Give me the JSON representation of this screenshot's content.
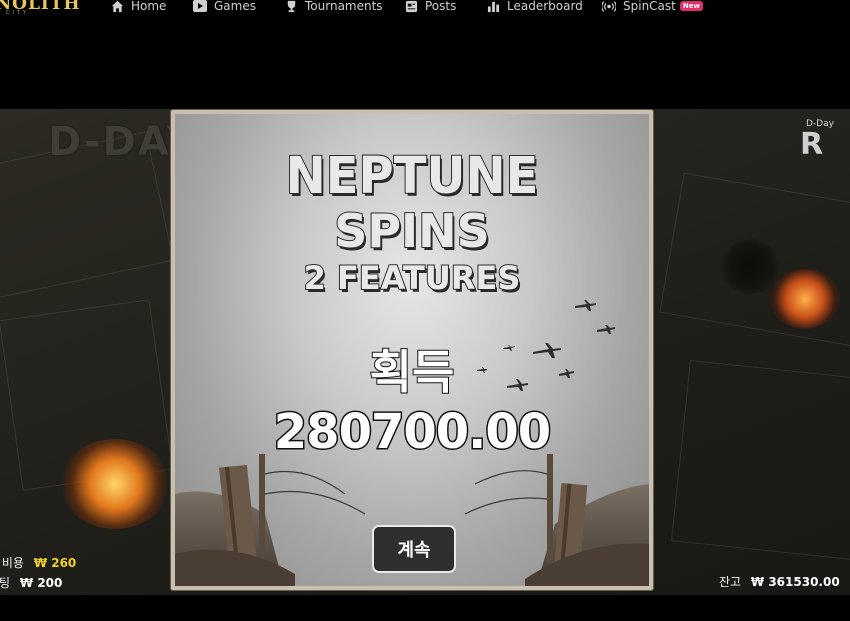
{
  "logo": {
    "text": "MONOLITH",
    "sub": "CITY"
  },
  "nav": [
    {
      "label": "Home",
      "icon": "home-icon"
    },
    {
      "label": "Games",
      "icon": "play-icon"
    },
    {
      "label": "Tournaments",
      "icon": "trophy-icon"
    },
    {
      "label": "Posts",
      "icon": "posts-icon"
    },
    {
      "label": "Leaderboard",
      "icon": "leaderboard-icon"
    },
    {
      "label": "SpinCast",
      "icon": "broadcast-icon",
      "badge": "New"
    }
  ],
  "game": {
    "title": "D-DAY",
    "rating_label": "D-Day",
    "rating_letter": "R",
    "cost_label": "구매 비용",
    "cost_value": "₩ 260",
    "bet_label": "베팅",
    "bet_value": "₩ 200",
    "balance_label": "잔고",
    "balance_value": "₩ 361530.00"
  },
  "modal": {
    "title_line1": "NEPTUNE",
    "title_line2": "SPINS",
    "title_line3": "2 FEATURES",
    "win_label": "획득",
    "win_amount": "280700.00",
    "continue_label": "계속"
  },
  "colors": {
    "accent_gold": "#f2d21a",
    "new_badge": "#e0306a",
    "background": "#000000"
  }
}
